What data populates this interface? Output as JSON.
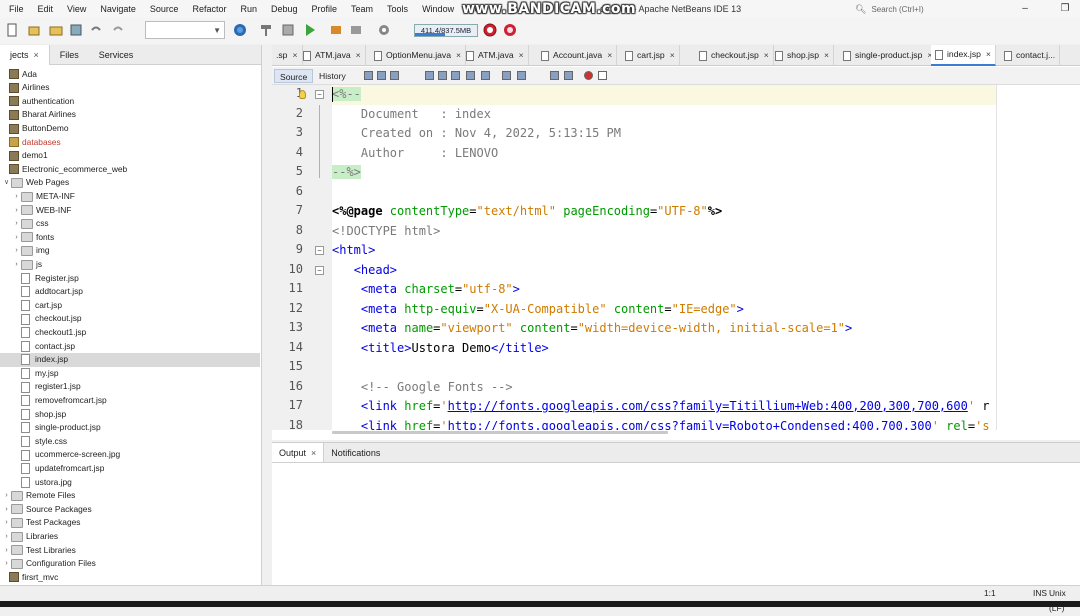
{
  "menu": [
    "File",
    "Edit",
    "View",
    "Navigate",
    "Source",
    "Refactor",
    "Run",
    "Debug",
    "Profile",
    "Team",
    "Tools",
    "Window",
    "Help"
  ],
  "window_title": "se_web - Apache NetBeans IDE 13",
  "search_placeholder": "Search (Ctrl+I)",
  "watermark": "www.BANDICAM.com",
  "memory": "411.4/837.5MB",
  "memory_fraction": 0.49,
  "left_tabs": [
    {
      "label": "jects",
      "close": "×"
    },
    {
      "label": "Files"
    },
    {
      "label": "Services"
    }
  ],
  "tree": [
    {
      "label": "Ada",
      "type": "proj",
      "level": 0,
      "toggle": ""
    },
    {
      "label": "Airlines",
      "type": "proj",
      "level": 0,
      "toggle": ""
    },
    {
      "label": "authentication",
      "type": "proj",
      "level": 0,
      "toggle": ""
    },
    {
      "label": "Bharat Airlines",
      "type": "proj",
      "level": 0,
      "toggle": ""
    },
    {
      "label": "ButtonDemo",
      "type": "proj",
      "level": 0,
      "toggle": ""
    },
    {
      "label": "databases",
      "type": "db",
      "level": 0,
      "toggle": "",
      "red": true
    },
    {
      "label": "demo1",
      "type": "proj",
      "level": 0,
      "toggle": ""
    },
    {
      "label": "Electronic_ecommerce_web",
      "type": "proj",
      "level": 0,
      "toggle": ""
    },
    {
      "label": "Web Pages",
      "type": "folder",
      "level": 1,
      "toggle": "∨"
    },
    {
      "label": "META-INF",
      "type": "folder",
      "level": 2,
      "toggle": "›"
    },
    {
      "label": "WEB-INF",
      "type": "folder",
      "level": 2,
      "toggle": "›"
    },
    {
      "label": "css",
      "type": "folder",
      "level": 2,
      "toggle": "›"
    },
    {
      "label": "fonts",
      "type": "folder",
      "level": 2,
      "toggle": "›"
    },
    {
      "label": "img",
      "type": "folder",
      "level": 2,
      "toggle": "›"
    },
    {
      "label": "js",
      "type": "folder",
      "level": 2,
      "toggle": "›"
    },
    {
      "label": "Register.jsp",
      "type": "file",
      "level": 2,
      "toggle": ""
    },
    {
      "label": "addtocart.jsp",
      "type": "file",
      "level": 2,
      "toggle": ""
    },
    {
      "label": "cart.jsp",
      "type": "file",
      "level": 2,
      "toggle": ""
    },
    {
      "label": "checkout.jsp",
      "type": "file",
      "level": 2,
      "toggle": ""
    },
    {
      "label": "checkout1.jsp",
      "type": "file",
      "level": 2,
      "toggle": ""
    },
    {
      "label": "contact.jsp",
      "type": "file",
      "level": 2,
      "toggle": ""
    },
    {
      "label": "index.jsp",
      "type": "file",
      "level": 2,
      "toggle": "",
      "selected": true
    },
    {
      "label": "my.jsp",
      "type": "file",
      "level": 2,
      "toggle": ""
    },
    {
      "label": "register1.jsp",
      "type": "file",
      "level": 2,
      "toggle": ""
    },
    {
      "label": "removefromcart.jsp",
      "type": "file",
      "level": 2,
      "toggle": ""
    },
    {
      "label": "shop.jsp",
      "type": "file",
      "level": 2,
      "toggle": ""
    },
    {
      "label": "single-product.jsp",
      "type": "file",
      "level": 2,
      "toggle": ""
    },
    {
      "label": "style.css",
      "type": "file",
      "level": 2,
      "toggle": ""
    },
    {
      "label": "ucommerce-screen.jpg",
      "type": "file",
      "level": 2,
      "toggle": ""
    },
    {
      "label": "updatefromcart.jsp",
      "type": "file",
      "level": 2,
      "toggle": ""
    },
    {
      "label": "ustora.jpg",
      "type": "file",
      "level": 2,
      "toggle": ""
    },
    {
      "label": "Remote Files",
      "type": "folder",
      "level": 1,
      "toggle": "›"
    },
    {
      "label": "Source Packages",
      "type": "folder",
      "level": 1,
      "toggle": "›"
    },
    {
      "label": "Test Packages",
      "type": "folder",
      "level": 1,
      "toggle": "›"
    },
    {
      "label": "Libraries",
      "type": "folder",
      "level": 1,
      "toggle": "›"
    },
    {
      "label": "Test Libraries",
      "type": "folder",
      "level": 1,
      "toggle": "›"
    },
    {
      "label": "Configuration Files",
      "type": "folder",
      "level": 1,
      "toggle": "›"
    },
    {
      "label": "firsrt_mvc",
      "type": "proj",
      "level": 0,
      "toggle": ""
    }
  ],
  "file_tabs": [
    {
      "label": ".sp",
      "close": "×"
    },
    {
      "label": "ATM.java",
      "close": "×"
    },
    {
      "label": "OptionMenu.java",
      "close": "×"
    },
    {
      "label": "ATM.java",
      "close": "×"
    },
    {
      "label": "Account.java",
      "close": "×"
    },
    {
      "label": "cart.jsp",
      "close": "×"
    },
    {
      "label": "checkout.jsp",
      "close": "×"
    },
    {
      "label": "shop.jsp",
      "close": "×"
    },
    {
      "label": "single-product.jsp",
      "close": "×"
    },
    {
      "label": "index.jsp",
      "close": "×",
      "active": true
    },
    {
      "label": "contact.j...",
      "close": ""
    }
  ],
  "editor_tabs": [
    "Source",
    "History"
  ],
  "code_lines": [
    {
      "n": "1",
      "segs": [
        [
          "hl",
          "<%--"
        ]
      ]
    },
    {
      "n": "2",
      "segs": [
        [
          "com",
          "    Document   : index"
        ]
      ]
    },
    {
      "n": "3",
      "segs": [
        [
          "com",
          "    Created on : Nov 4, 2022, 5:13:15 PM"
        ]
      ]
    },
    {
      "n": "4",
      "segs": [
        [
          "com",
          "    Author     : LENOVO"
        ]
      ]
    },
    {
      "n": "5",
      "segs": [
        [
          "hl",
          "--%>"
        ]
      ]
    },
    {
      "n": "6",
      "segs": []
    },
    {
      "n": "7",
      "segs": [
        [
          "dir",
          "<%@page "
        ],
        [
          "attr",
          "contentType"
        ],
        [
          "txt",
          "="
        ],
        [
          "str",
          "\"text/html\""
        ],
        [
          "txt",
          " "
        ],
        [
          "attr",
          "pageEncoding"
        ],
        [
          "txt",
          "="
        ],
        [
          "str",
          "\"UTF-8\""
        ],
        [
          "dir",
          "%>"
        ]
      ]
    },
    {
      "n": "8",
      "segs": [
        [
          "com",
          "<!DOCTYPE html>"
        ]
      ]
    },
    {
      "n": "9",
      "segs": [
        [
          "tag",
          "<html>"
        ]
      ]
    },
    {
      "n": "10",
      "segs": [
        [
          "txt",
          "   "
        ],
        [
          "tag",
          "<head>"
        ]
      ]
    },
    {
      "n": "11",
      "segs": [
        [
          "txt",
          "    "
        ],
        [
          "tag",
          "<meta "
        ],
        [
          "attr",
          "charset"
        ],
        [
          "txt",
          "="
        ],
        [
          "str",
          "\"utf-8\""
        ],
        [
          "tag",
          ">"
        ]
      ]
    },
    {
      "n": "12",
      "segs": [
        [
          "txt",
          "    "
        ],
        [
          "tag",
          "<meta "
        ],
        [
          "attr",
          "http-equiv"
        ],
        [
          "txt",
          "="
        ],
        [
          "str",
          "\"X-UA-Compatible\""
        ],
        [
          "txt",
          " "
        ],
        [
          "attr",
          "content"
        ],
        [
          "txt",
          "="
        ],
        [
          "str",
          "\"IE=edge\""
        ],
        [
          "tag",
          ">"
        ]
      ]
    },
    {
      "n": "13",
      "segs": [
        [
          "txt",
          "    "
        ],
        [
          "tag",
          "<meta "
        ],
        [
          "attr",
          "name"
        ],
        [
          "txt",
          "="
        ],
        [
          "str",
          "\"viewport\""
        ],
        [
          "txt",
          " "
        ],
        [
          "attr",
          "content"
        ],
        [
          "txt",
          "="
        ],
        [
          "str",
          "\"width=device-width, initial-scale=1\""
        ],
        [
          "tag",
          ">"
        ]
      ]
    },
    {
      "n": "14",
      "segs": [
        [
          "txt",
          "    "
        ],
        [
          "tag",
          "<title>"
        ],
        [
          "txt",
          "Ustora Demo"
        ],
        [
          "tag",
          "</title>"
        ]
      ]
    },
    {
      "n": "15",
      "segs": []
    },
    {
      "n": "16",
      "segs": [
        [
          "txt",
          "    "
        ],
        [
          "com",
          "<!-- Google Fonts -->"
        ]
      ]
    },
    {
      "n": "17",
      "segs": [
        [
          "txt",
          "    "
        ],
        [
          "tag",
          "<link "
        ],
        [
          "attr",
          "href"
        ],
        [
          "txt",
          "="
        ],
        [
          "str",
          "'"
        ],
        [
          "url",
          "http://fonts.googleapis.com/css?family=Titillium+Web:400,200,300,700,600"
        ],
        [
          "str",
          "'"
        ],
        [
          "txt",
          " r"
        ]
      ]
    },
    {
      "n": "18",
      "segs": [
        [
          "txt",
          "    "
        ],
        [
          "tag",
          "<link "
        ],
        [
          "attr",
          "href"
        ],
        [
          "txt",
          "="
        ],
        [
          "str",
          "'"
        ],
        [
          "url",
          "http://fonts.googleapis.com/css?family=Roboto+Condensed:400,700,300"
        ],
        [
          "str",
          "'"
        ],
        [
          "txt",
          " "
        ],
        [
          "attr",
          "rel"
        ],
        [
          "txt",
          "="
        ],
        [
          "str",
          "'s"
        ]
      ]
    }
  ],
  "output_tabs": [
    {
      "label": "Output",
      "close": "×"
    },
    {
      "label": "Notifications",
      "close": ""
    }
  ],
  "status": {
    "position": "1:1",
    "mode": "INS",
    "encoding": "Unix (LF)"
  }
}
